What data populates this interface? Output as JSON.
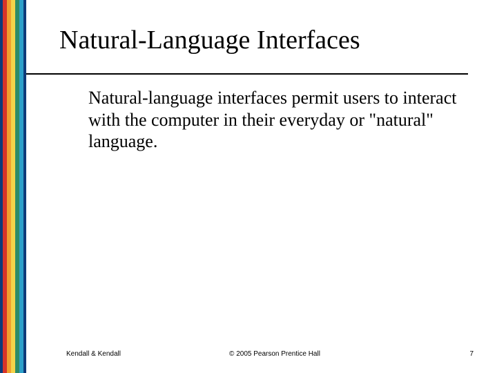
{
  "slide": {
    "title": "Natural-Language Interfaces",
    "body": "Natural-language interfaces permit users to interact with the computer in their everyday or \"natural\" language."
  },
  "footer": {
    "left": "Kendall & Kendall",
    "center": "© 2005 Pearson Prentice Hall",
    "right": "7"
  }
}
